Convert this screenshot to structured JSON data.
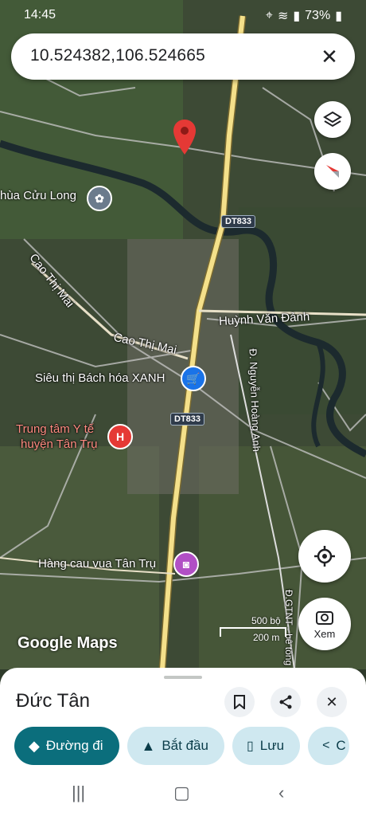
{
  "status": {
    "time": "14:45",
    "battery": "73%"
  },
  "search": {
    "value": "10.524382,106.524665",
    "close_icon": "close-icon"
  },
  "map": {
    "labels": {
      "chua": "hùa Cửu Long",
      "cao1": "Cao Thị Mai",
      "cao2": "Cao Thị Mai",
      "huynh": "Huỳnh Văn Đảnh",
      "nguyen": "Đ. Nguyễn Hoàng Anh",
      "dt1": "DT833",
      "dt2": "DT833",
      "sieu": "Siêu thị Bách hóa XANH",
      "ytet1": "Trung tâm Y tế",
      "ytet2": "huyện Tân Trụ",
      "hang": "Hàng cau vua Tân Trụ",
      "scale1": "500 bộ",
      "scale2": "200 m",
      "road": "Đ.GTNT - bê tông",
      "google": "Google Maps"
    },
    "locate_label": "Xem"
  },
  "sheet": {
    "place": "Đức Tân",
    "chips": {
      "directions": "Đường đi",
      "start": "Bắt đầu",
      "save": "Lưu",
      "share": "C"
    }
  },
  "colors": {
    "accent": "#0b6e7c",
    "tonal": "#cfe8f0",
    "pin": "#e53935",
    "road": "#f4e08a"
  }
}
